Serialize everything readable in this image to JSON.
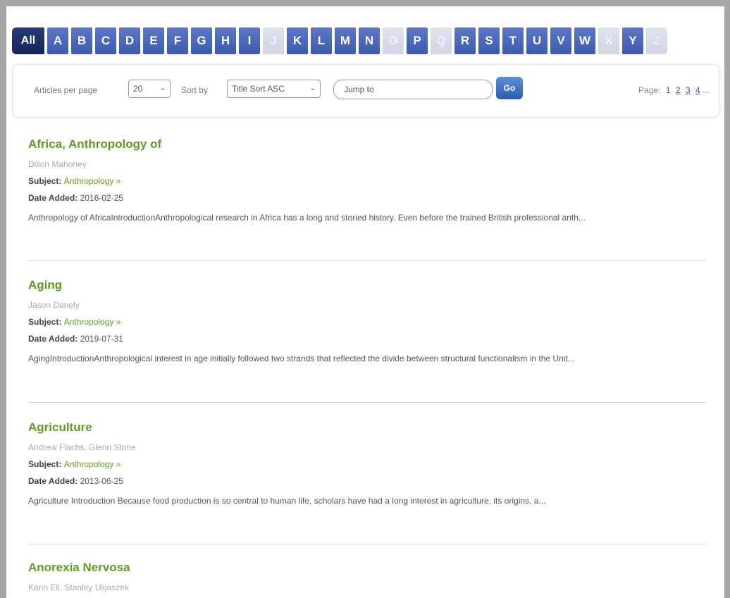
{
  "alphabet": [
    {
      "label": "All",
      "state": "active"
    },
    {
      "label": "A",
      "state": "enabled"
    },
    {
      "label": "B",
      "state": "enabled"
    },
    {
      "label": "C",
      "state": "enabled"
    },
    {
      "label": "D",
      "state": "enabled"
    },
    {
      "label": "E",
      "state": "enabled"
    },
    {
      "label": "F",
      "state": "enabled"
    },
    {
      "label": "G",
      "state": "enabled"
    },
    {
      "label": "H",
      "state": "enabled"
    },
    {
      "label": "I",
      "state": "enabled"
    },
    {
      "label": "J",
      "state": "disabled"
    },
    {
      "label": "K",
      "state": "enabled"
    },
    {
      "label": "L",
      "state": "enabled"
    },
    {
      "label": "M",
      "state": "enabled"
    },
    {
      "label": "N",
      "state": "enabled"
    },
    {
      "label": "O",
      "state": "disabled"
    },
    {
      "label": "P",
      "state": "enabled"
    },
    {
      "label": "Q",
      "state": "disabled"
    },
    {
      "label": "R",
      "state": "enabled"
    },
    {
      "label": "S",
      "state": "enabled"
    },
    {
      "label": "T",
      "state": "enabled"
    },
    {
      "label": "U",
      "state": "enabled"
    },
    {
      "label": "V",
      "state": "enabled"
    },
    {
      "label": "W",
      "state": "enabled"
    },
    {
      "label": "X",
      "state": "disabled"
    },
    {
      "label": "Y",
      "state": "enabled"
    },
    {
      "label": "Z",
      "state": "disabled"
    }
  ],
  "controls": {
    "per_page_label": "Articles per page",
    "per_page_value": "20",
    "sort_label": "Sort by",
    "sort_value": "Title Sort ASC",
    "jump_placeholder": "Jump to",
    "go_label": "Go",
    "page_label": "Page:",
    "pages": [
      "1",
      "2",
      "3",
      "4"
    ],
    "pages_more": "..."
  },
  "labels": {
    "subject": "Subject:",
    "date_added": "Date Added:"
  },
  "articles": [
    {
      "title": "Africa, Anthropology of",
      "authors": "Dillon Mahoney",
      "subject": "Anthropology »",
      "date_added": "2016-02-25",
      "excerpt": "Anthropology of AfricaIntroductionAnthropological research in Africa has a long and storied history. Even before the trained British professional anth..."
    },
    {
      "title": "Aging",
      "authors": "Jason Danely",
      "subject": "Anthropology »",
      "date_added": "2019-07-31",
      "excerpt": "AgingIntroductionAnthropological interest in age initially followed two strands that reflected the divide between structural functionalism in the Unit..."
    },
    {
      "title": "Agriculture",
      "authors": "Andrew Flachs, Glenn Stone",
      "subject": "Anthropology »",
      "date_added": "2013-06-25",
      "excerpt": "Agriculture Introduction Because food production is so central to human life, scholars have had a long interest in agriculture, its origins, a..."
    },
    {
      "title": "Anorexia Nervosa",
      "authors": "Karin Eli, Stanley Ulijaszek",
      "subject": "",
      "date_added": "",
      "excerpt": ""
    }
  ],
  "colors": {
    "accent_green": "#5d9c1f",
    "letter_blue": "#3c58b0",
    "all_navy": "#142659"
  }
}
